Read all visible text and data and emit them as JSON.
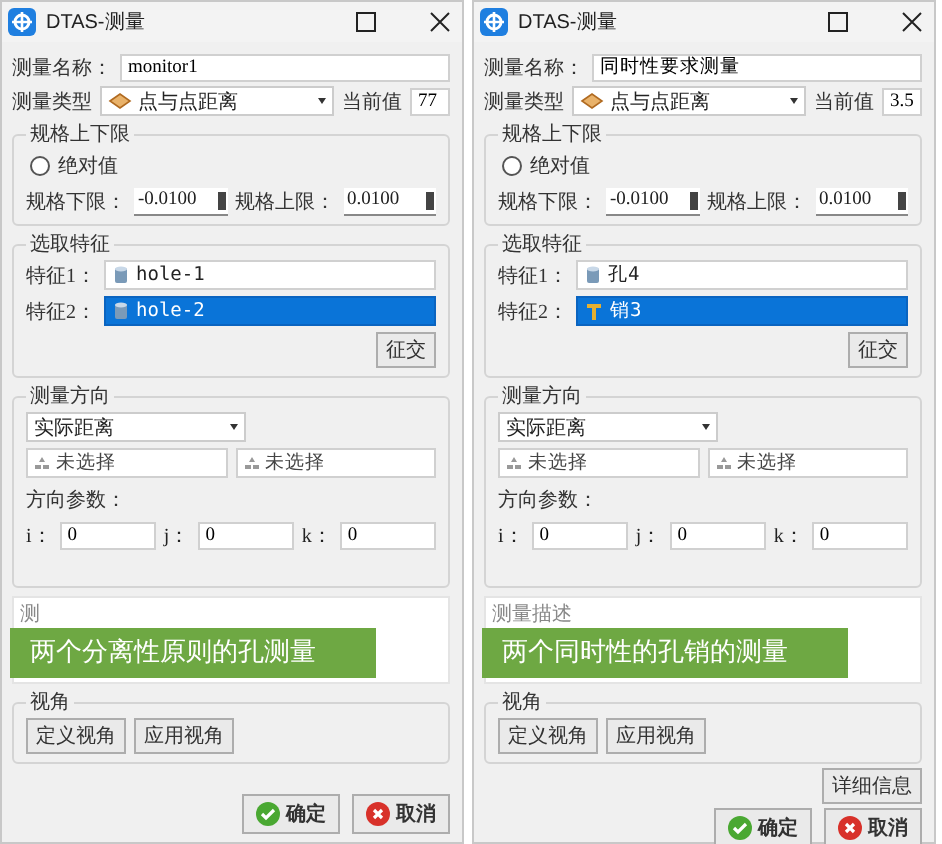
{
  "windows": [
    {
      "title": "DTAS-测量",
      "name_label": "测量名称：",
      "name_value": "monitor1",
      "type_label": "测量类型",
      "type_value": "点与点距离",
      "current_label": "当前值",
      "current_value": "77",
      "limits": {
        "title": "规格上下限",
        "absolute_label": "绝对值",
        "absolute_checked": false,
        "lower_label": "规格下限：",
        "lower_value": "-0.0100",
        "upper_label": "规格上限：",
        "upper_value": "0.0100"
      },
      "features": {
        "title": "选取特征",
        "items": [
          {
            "label": "特征1：",
            "value": "hole-1",
            "selected": false,
            "kind": "hole"
          },
          {
            "label": "特征2：",
            "value": "hole-2",
            "selected": true,
            "kind": "hole"
          }
        ],
        "button": "征交"
      },
      "direction": {
        "title": "测量方向",
        "mode": "实际距离",
        "pickers": [
          "未选择",
          "未选择"
        ],
        "params_label": "方向参数：",
        "params": [
          {
            "label": "i：",
            "value": "0"
          },
          {
            "label": "j：",
            "value": "0"
          },
          {
            "label": "k：",
            "value": "0"
          }
        ]
      },
      "description_placeholder": "测",
      "banner": "两个分离性原则的孔测量",
      "view": {
        "title": "视角",
        "buttons": [
          "定义视角",
          "应用视角"
        ]
      },
      "ok": "确定",
      "cancel": "取消"
    },
    {
      "title": "DTAS-测量",
      "name_label": "测量名称：",
      "name_value": "同时性要求测量",
      "type_label": "测量类型",
      "type_value": "点与点距离",
      "current_label": "当前值",
      "current_value": "3.5",
      "limits": {
        "title": "规格上下限",
        "absolute_label": "绝对值",
        "absolute_checked": false,
        "lower_label": "规格下限：",
        "lower_value": "-0.0100",
        "upper_label": "规格上限：",
        "upper_value": "0.0100"
      },
      "features": {
        "title": "选取特征",
        "items": [
          {
            "label": "特征1：",
            "value": "孔4",
            "selected": false,
            "kind": "hole"
          },
          {
            "label": "特征2：",
            "value": "销3",
            "selected": true,
            "kind": "pin"
          }
        ],
        "button": "征交"
      },
      "direction": {
        "title": "测量方向",
        "mode": "实际距离",
        "pickers": [
          "未选择",
          "未选择"
        ],
        "params_label": "方向参数：",
        "params": [
          {
            "label": "i：",
            "value": "0"
          },
          {
            "label": "j：",
            "value": "0"
          },
          {
            "label": "k：",
            "value": "0"
          }
        ]
      },
      "description_placeholder": "测量描述",
      "banner": "两个同时性的孔销的测量",
      "view": {
        "title": "视角",
        "buttons": [
          "定义视角",
          "应用视角"
        ]
      },
      "detail_button": "详细信息",
      "ok": "确定",
      "cancel": "取消"
    }
  ]
}
